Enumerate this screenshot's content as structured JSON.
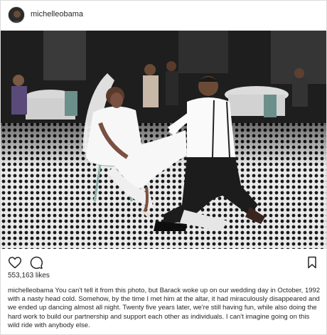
{
  "post": {
    "username": "michelleobama",
    "likes": "553,163 likes",
    "caption_user": "michelleobama",
    "caption_text": "You can't tell it from this photo, but Barack woke up on our wedding day in October, 1992 with a nasty head cold. Somehow, by the time I met him at the altar, it had miraculously disappeared and we ended up dancing almost all night. Twenty five years later, we're still having fun, while also doing the hard work to build our partnership and support each other as individuals. I can't imagine going on this wild ride with anybody else.",
    "photo_description_icon": "wedding-photo"
  },
  "icons": {
    "like": "heart-icon",
    "comment": "comment-icon",
    "save": "bookmark-icon"
  },
  "colors": {
    "text": "#262626",
    "border": "#dbdbdb"
  }
}
